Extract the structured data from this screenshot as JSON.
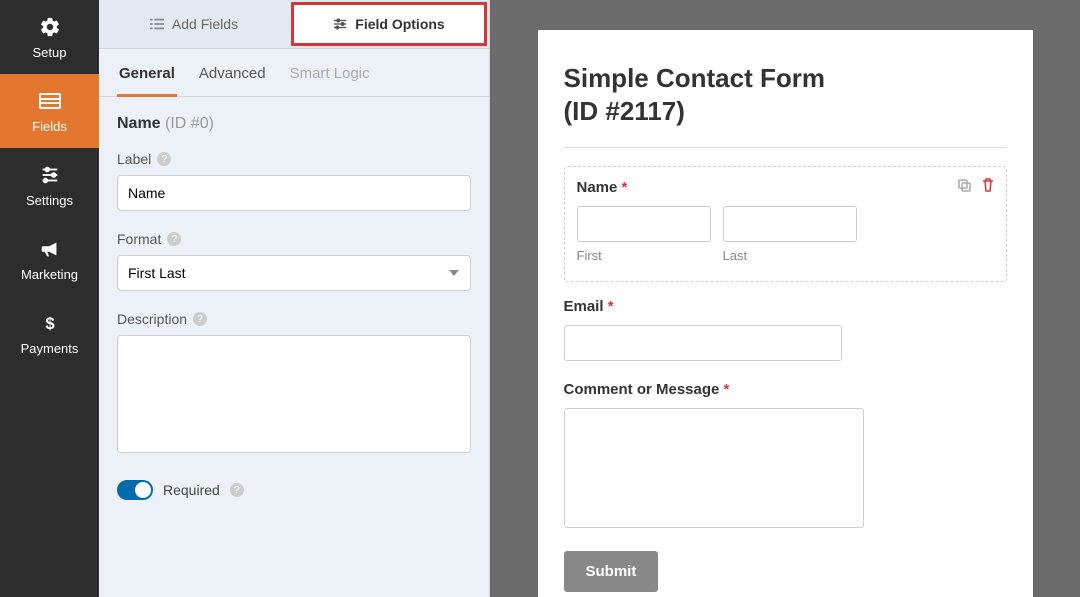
{
  "sidebar": {
    "items": [
      {
        "label": "Setup"
      },
      {
        "label": "Fields"
      },
      {
        "label": "Settings"
      },
      {
        "label": "Marketing"
      },
      {
        "label": "Payments"
      }
    ]
  },
  "panel": {
    "top_tabs": {
      "add_fields": "Add Fields",
      "field_options": "Field Options"
    },
    "sub_tabs": {
      "general": "General",
      "advanced": "Advanced",
      "smart_logic": "Smart Logic"
    },
    "field_title_name": "Name",
    "field_title_id": "(ID #0)",
    "label_label": "Label",
    "label_value": "Name",
    "format_label": "Format",
    "format_value": "First Last",
    "description_label": "Description",
    "description_value": "",
    "required_label": "Required"
  },
  "preview": {
    "title_line1": "Simple Contact Form",
    "title_line2": "(ID #2117)",
    "fields": {
      "name": {
        "label": "Name",
        "first": "First",
        "last": "Last"
      },
      "email": {
        "label": "Email"
      },
      "message": {
        "label": "Comment or Message"
      }
    },
    "submit": "Submit"
  }
}
